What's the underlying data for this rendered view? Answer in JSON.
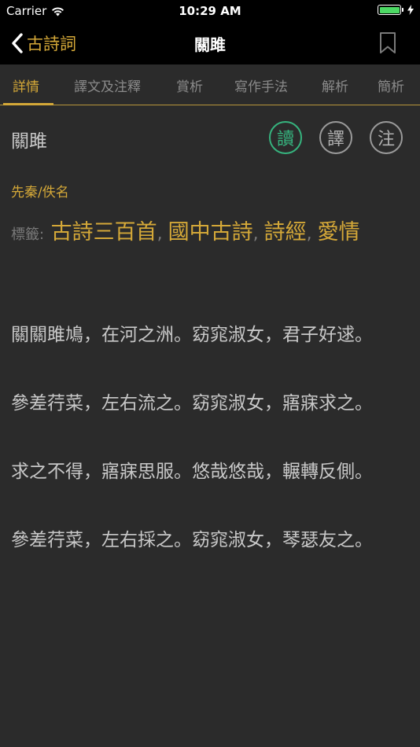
{
  "status_bar": {
    "carrier": "Carrier",
    "time": "10:29 AM",
    "battery_level": 1.0,
    "battery_color": "#4cd964"
  },
  "nav": {
    "back_label": "古詩詞",
    "title": "關雎",
    "bookmark_icon": "bookmark-icon"
  },
  "tabs": [
    {
      "label": "詳情",
      "active": true
    },
    {
      "label": "譯文及注釋",
      "active": false
    },
    {
      "label": "賞析",
      "active": false
    },
    {
      "label": "寫作手法",
      "active": false
    },
    {
      "label": "解析",
      "active": false
    },
    {
      "label": "簡析",
      "active": false
    }
  ],
  "poem": {
    "title": "關雎",
    "author": "先秦/佚名",
    "tags_label": "標籤:",
    "tags": [
      "古詩三百首",
      "國中古詩",
      "詩經",
      "愛情"
    ],
    "stanzas": [
      "關關雎鳩，在河之洲。窈窕淑女，君子好逑。",
      "參差荇菜，左右流之。窈窕淑女，寤寐求之。",
      "求之不得，寤寐思服。悠哉悠哉，輾轉反側。",
      "參差荇菜，左右採之。窈窕淑女，琴瑟友之。"
    ]
  },
  "actions": {
    "read_label": "讀",
    "translate_label": "譯",
    "note_label": "注"
  },
  "colors": {
    "accent": "#d4a838",
    "active_action": "#36b37e",
    "background": "#2b2b2b",
    "bar_background": "#000000"
  }
}
